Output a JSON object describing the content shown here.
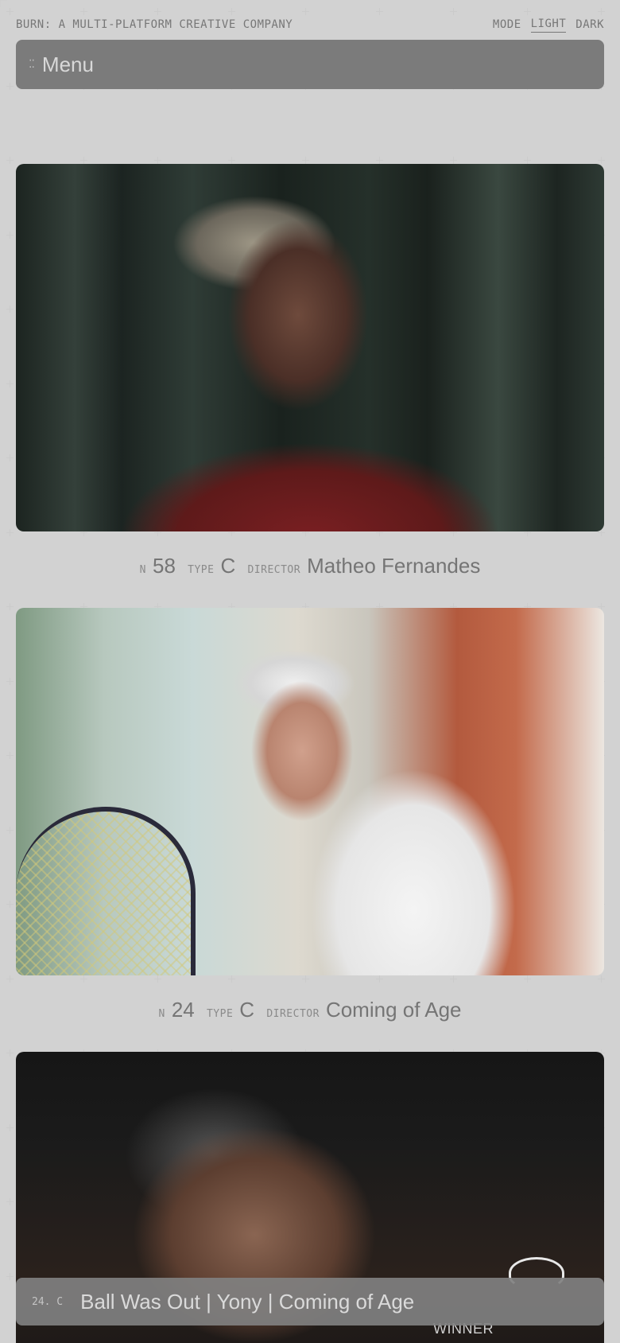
{
  "header": {
    "site_title": "BURN: A MULTI-PLATFORM CREATIVE COMPANY",
    "mode_label": "MODE",
    "mode_light": "LIGHT",
    "mode_dark": "DARK"
  },
  "menu": {
    "icon": "grip-dots-icon",
    "label": "Menu"
  },
  "projects": [
    {
      "n_label": "N",
      "number": "58",
      "type_label": "TYPE",
      "type": "C",
      "director_label": "DIRECTOR",
      "director": "Matheo Fernandes"
    },
    {
      "n_label": "N",
      "number": "24",
      "type_label": "TYPE",
      "type": "C",
      "director_label": "DIRECTOR",
      "director": "Coming of Age"
    }
  ],
  "now_playing": {
    "code": "24. C",
    "title": "Ball Was Out | Yony | Coming of Age",
    "overlay_text": "WINNER"
  }
}
